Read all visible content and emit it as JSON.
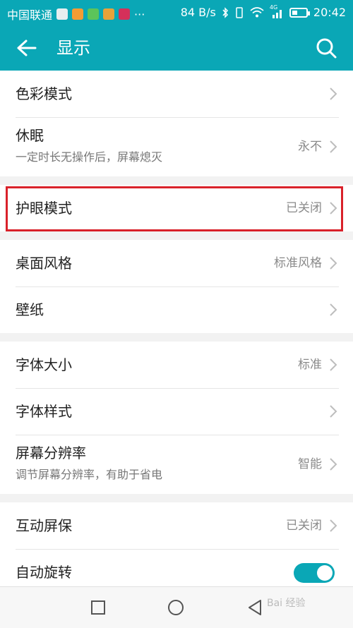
{
  "status_bar": {
    "carrier": "中国联通",
    "dots": "···",
    "speed": "84 B/s",
    "network_type": "4G",
    "time": "20:42",
    "icons": [
      "notification-icon",
      "video-app-icon",
      "play-app-icon",
      "game-app-icon",
      "tv-app-icon",
      "bluetooth-icon",
      "vibrate-icon",
      "wifi-icon",
      "signal-icon",
      "battery-icon"
    ],
    "colors": {
      "bar": "#0aa7b6"
    }
  },
  "header": {
    "title": "显示",
    "icons": [
      "back-arrow-icon",
      "search-icon"
    ]
  },
  "sections": [
    {
      "items": [
        {
          "title": "色彩模式",
          "value": "",
          "icon": "chevron-right-icon"
        },
        {
          "title": "休眠",
          "subtitle": "一定时长无操作后，屏幕熄灭",
          "value": "永不",
          "icon": "chevron-right-icon"
        }
      ]
    },
    {
      "items": [
        {
          "title": "护眼模式",
          "value": "已关闭",
          "icon": "chevron-right-icon",
          "highlighted": true
        }
      ]
    },
    {
      "items": [
        {
          "title": "桌面风格",
          "value": "标准风格",
          "icon": "chevron-right-icon"
        },
        {
          "title": "壁纸",
          "value": "",
          "icon": "chevron-right-icon"
        }
      ]
    },
    {
      "items": [
        {
          "title": "字体大小",
          "value": "标准",
          "icon": "chevron-right-icon"
        },
        {
          "title": "字体样式",
          "value": "",
          "icon": "chevron-right-icon"
        },
        {
          "title": "屏幕分辨率",
          "subtitle": "调节屏幕分辨率，有助于省电",
          "value": "智能",
          "icon": "chevron-right-icon"
        }
      ]
    },
    {
      "items": [
        {
          "title": "互动屏保",
          "value": "已关闭",
          "icon": "chevron-right-icon"
        },
        {
          "title": "自动旋转",
          "toggle": true,
          "toggle_on": true
        }
      ]
    }
  ],
  "highlight_color": "#d9212a",
  "nav_bar": {
    "icons": [
      "recent-apps-icon",
      "home-icon",
      "back-icon"
    ],
    "watermark": "Bai 经验"
  }
}
